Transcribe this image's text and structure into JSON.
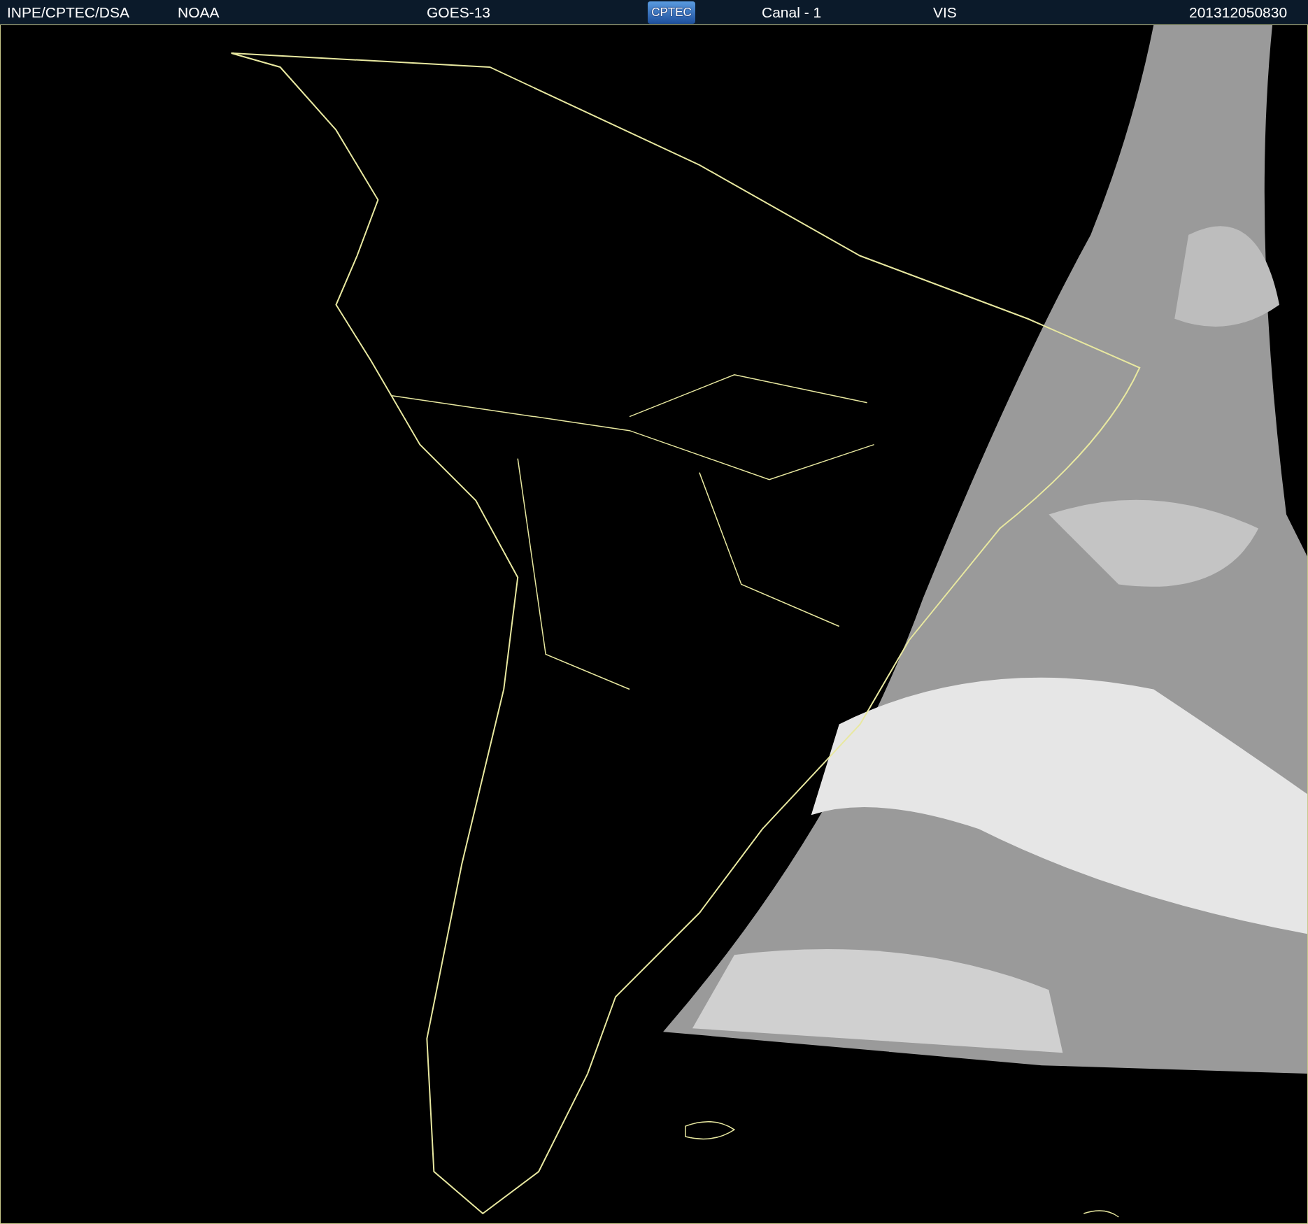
{
  "header": {
    "source": "INPE/CPTEC/DSA",
    "agency": "NOAA",
    "satellite": "GOES-13",
    "logo": "CPTEC",
    "channel": "Canal - 1",
    "band": "VIS",
    "timestamp": "201312050830"
  }
}
